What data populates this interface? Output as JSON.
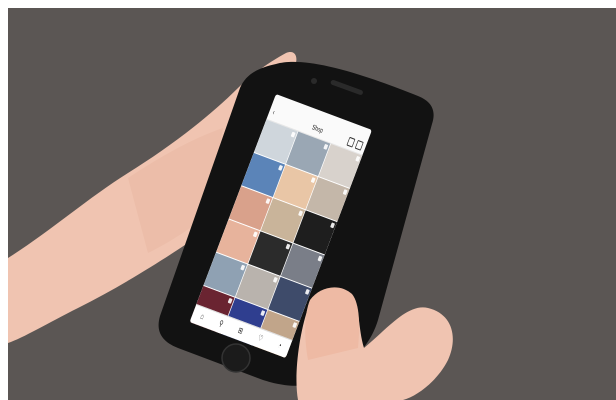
{
  "scene": {
    "background_color": "#5b5654",
    "skin_color": "#f2c6b3",
    "phone_color": "#121212"
  },
  "phone": {
    "status": {
      "time": "",
      "battery": ""
    },
    "header": {
      "title": "Shop",
      "back_icon": "chevron-left-icon",
      "right_icons": [
        "bag-icon",
        "list-icon"
      ]
    },
    "grid_colors": [
      "#cfd6dc",
      "#9aa7b4",
      "#d8d2cc",
      "#5b84b8",
      "#e9c6a6",
      "#c4b7a9",
      "#d9a18b",
      "#c9b49a",
      "#1e1e1e",
      "#e7b39c",
      "#2b2b2b",
      "#7a7e88",
      "#8fa1b3",
      "#b9b3ad",
      "#3e4b6a",
      "#6a2431",
      "#2f3e8f",
      "#c1a58a",
      "#7c1e1e",
      "#243b8a",
      "#d18b4b"
    ],
    "nav_icons": [
      "home-icon",
      "search-icon",
      "add-icon",
      "heart-icon",
      "profile-icon"
    ]
  }
}
